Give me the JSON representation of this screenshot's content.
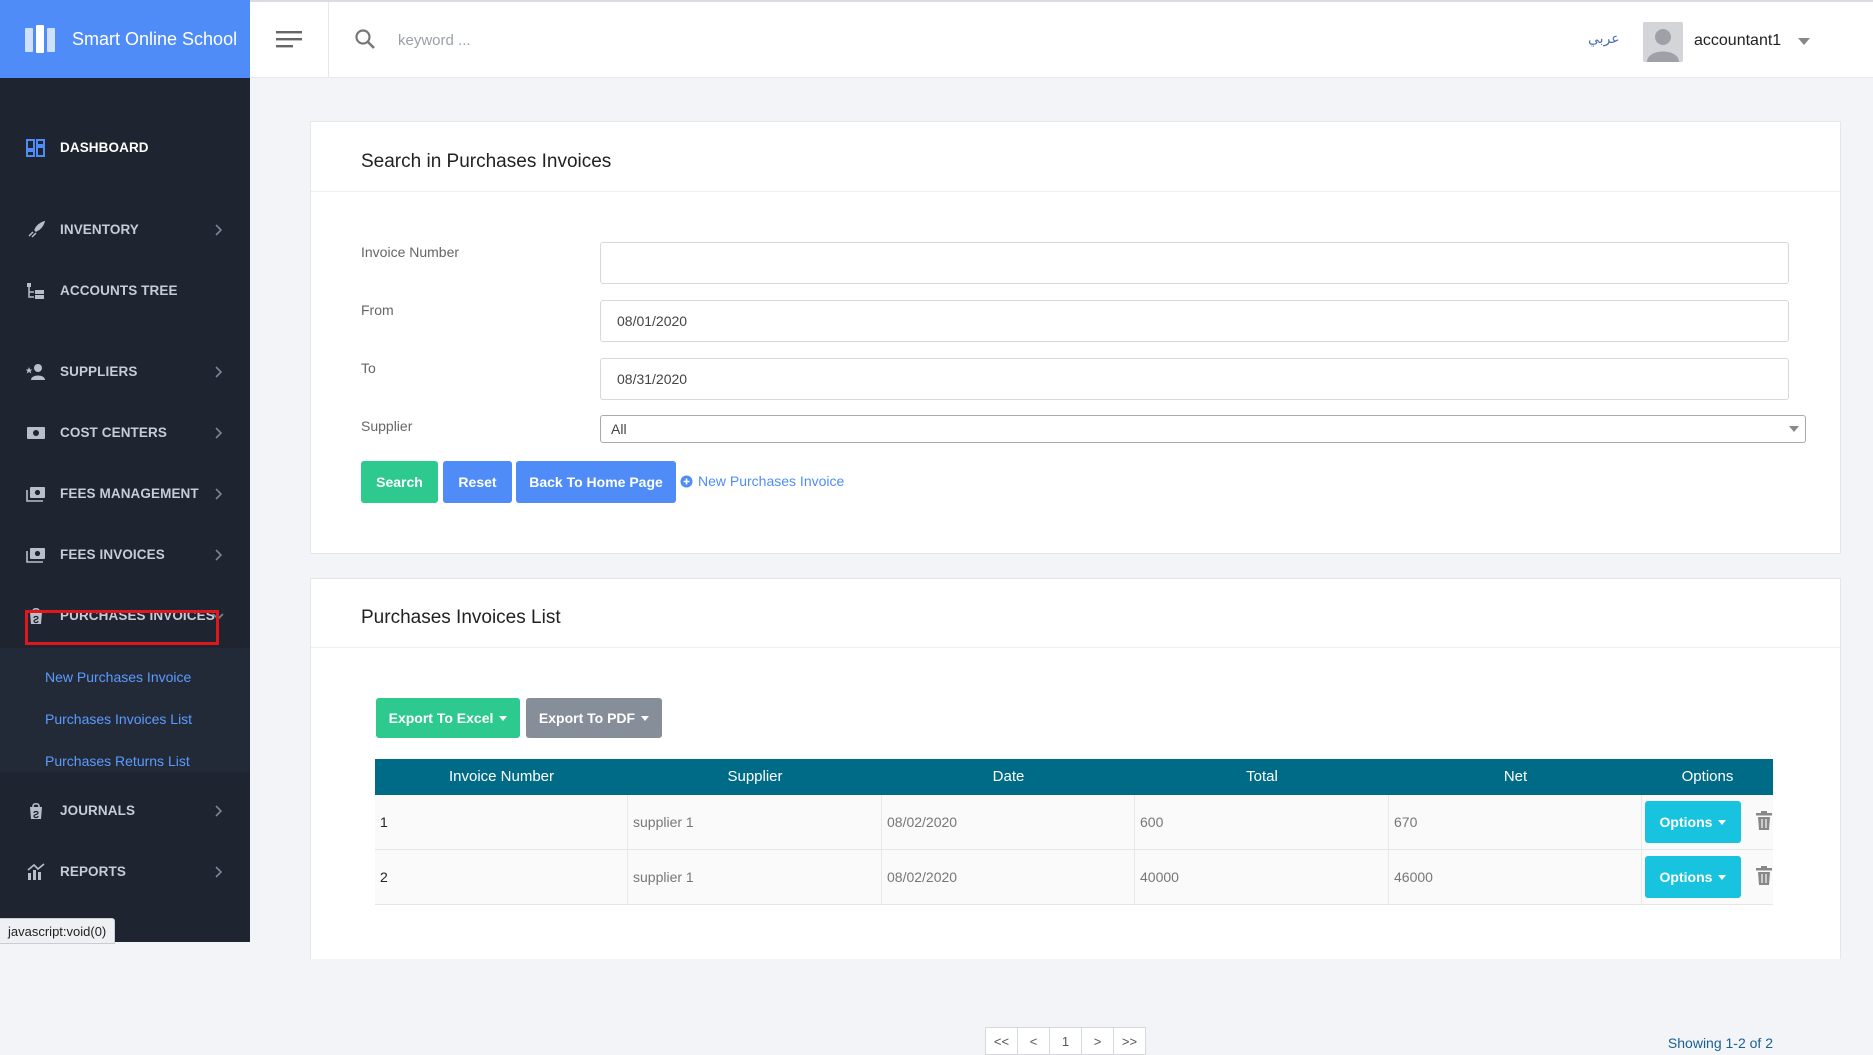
{
  "brand": {
    "name": "Smart Online School"
  },
  "topbar": {
    "search_placeholder": "keyword ...",
    "language": "عربي",
    "username": "accountant1"
  },
  "sidebar": {
    "items": [
      {
        "label": "DASHBOARD",
        "icon": "dashboard-icon"
      },
      {
        "label": "INVENTORY",
        "icon": "rocket-icon"
      },
      {
        "label": "ACCOUNTS TREE",
        "icon": "tree-icon"
      },
      {
        "label": "SUPPLIERS",
        "icon": "user-star-icon"
      },
      {
        "label": "COST CENTERS",
        "icon": "money-icon"
      },
      {
        "label": "FEES MANAGEMENT",
        "icon": "money-stack-icon"
      },
      {
        "label": "FEES INVOICES",
        "icon": "money-stack-icon"
      },
      {
        "label": "PURCHASES INVOICES",
        "icon": "shopping-bag-icon"
      },
      {
        "label": "JOURNALS",
        "icon": "shopping-bag-icon"
      },
      {
        "label": "REPORTS",
        "icon": "chart-icon"
      }
    ],
    "submenu": [
      "New Purchases Invoice",
      "Purchases Invoices List",
      "Purchases Returns List"
    ]
  },
  "status_bar": "javascript:void(0)",
  "search_card": {
    "title": "Search in Purchases Invoices",
    "fields": {
      "invoice_number": {
        "label": "Invoice Number",
        "value": ""
      },
      "from": {
        "label": "From",
        "value": "08/01/2020"
      },
      "to": {
        "label": "To",
        "value": "08/31/2020"
      },
      "supplier": {
        "label": "Supplier",
        "value": "All"
      }
    },
    "buttons": {
      "search": "Search",
      "reset": "Reset",
      "back": "Back To Home Page",
      "new_invoice": "New Purchases Invoice"
    }
  },
  "list_card": {
    "title": "Purchases Invoices List",
    "export_excel": "Export To Excel",
    "export_pdf": "Export To PDF",
    "columns": [
      "Invoice Number",
      "Supplier",
      "Date",
      "Total",
      "Net",
      "Options"
    ],
    "rows": [
      {
        "invoice_number": "1",
        "supplier": "supplier 1",
        "date": "08/02/2020",
        "total": "600",
        "net": "670"
      },
      {
        "invoice_number": "2",
        "supplier": "supplier 1",
        "date": "08/02/2020",
        "total": "40000",
        "net": "46000"
      }
    ],
    "options_label": "Options",
    "pagination": [
      "<<",
      "<",
      "1",
      ">",
      ">>"
    ],
    "showing": "Showing 1-2 of 2"
  },
  "colors": {
    "brand_blue": "#4f8cf7",
    "sidebar_bg": "#1e2430",
    "table_header": "#006b86",
    "green": "#2ec98f",
    "cyan": "#17c3de",
    "highlight_red": "#e0171c"
  }
}
